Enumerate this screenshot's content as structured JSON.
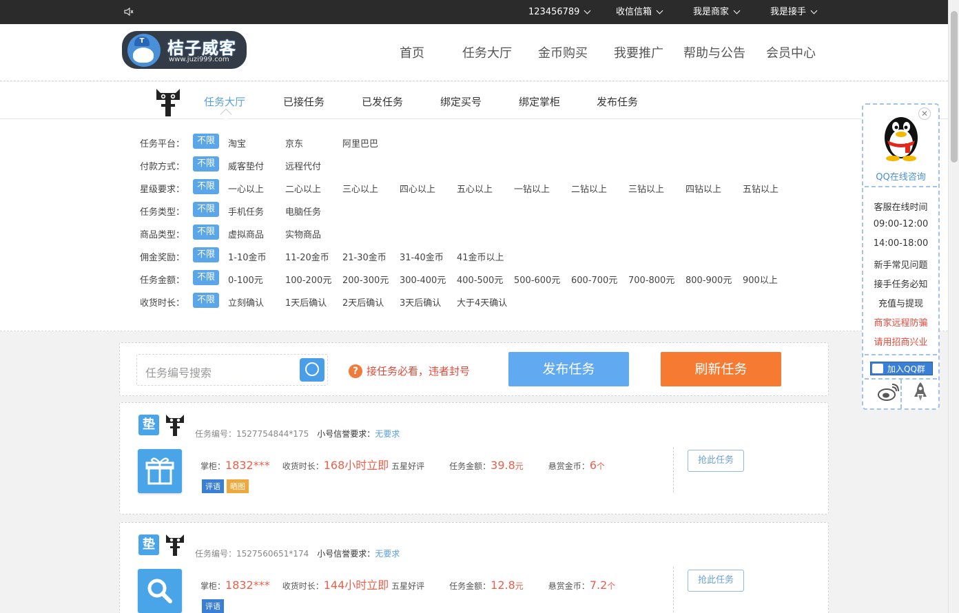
{
  "topbar": {
    "account": "123456789",
    "inbox": "收信信箱",
    "merchant": "我是商家",
    "receiver": "我是接手"
  },
  "logo": {
    "name": "桔子威客",
    "url": "www.juzi999.com",
    "hat_letter": "T"
  },
  "main_nav": [
    "首页",
    "任务大厅",
    "金币购买",
    "我要推广",
    "帮助与公告",
    "会员中心"
  ],
  "sub_nav": {
    "items": [
      "任务大厅",
      "已接任务",
      "已发任务",
      "绑定买号",
      "绑定掌柜",
      "发布任务"
    ],
    "active_index": 0
  },
  "filters": [
    {
      "label": "任务平台：",
      "badge": "不限",
      "options": [
        "淘宝",
        "京东",
        "阿里巴巴"
      ]
    },
    {
      "label": "付款方式：",
      "badge": "不限",
      "options": [
        "威客垫付",
        "远程代付"
      ]
    },
    {
      "label": "星级要求：",
      "badge": "不限",
      "options": [
        "一心以上",
        "二心以上",
        "三心以上",
        "四心以上",
        "五心以上",
        "一钻以上",
        "二钻以上",
        "三钻以上",
        "四钻以上",
        "五钻以上"
      ]
    },
    {
      "label": "任务类型：",
      "badge": "不限",
      "options": [
        "手机任务",
        "电脑任务"
      ]
    },
    {
      "label": "商品类型：",
      "badge": "不限",
      "options": [
        "虚拟商品",
        "实物商品"
      ]
    },
    {
      "label": "佣金奖励：",
      "badge": "不限",
      "options": [
        "1-10金币",
        "11-20金币",
        "21-30金币",
        "31-40金币",
        "41金币以上"
      ]
    },
    {
      "label": "任务金额：",
      "badge": "不限",
      "options": [
        "0-100元",
        "100-200元",
        "200-300元",
        "300-400元",
        "400-500元",
        "500-600元",
        "600-700元",
        "700-800元",
        "800-900元",
        "900以上"
      ]
    },
    {
      "label": "收货时长：",
      "badge": "不限",
      "options": [
        "立刻确认",
        "1天后确认",
        "2天后确认",
        "3天后确认",
        "大于4天确认"
      ]
    }
  ],
  "actions": {
    "search_placeholder": "任务编号搜索",
    "notice": "接任务必看，违者封号",
    "notice_icon": "?",
    "publish": "发布任务",
    "refresh": "刷新任务"
  },
  "tasks": [
    {
      "platform_tag": "垫",
      "id_label": "任务编号：",
      "id": "1527754844*175",
      "req_label": "小号信誉要求：",
      "req": "无要求",
      "icon": "gift-icon",
      "shop_label": "掌柜：",
      "shop": "1832***",
      "time_label": "收货时长：",
      "time": "168小时立即",
      "rating": "五星好评",
      "amount_label": "任务金额：",
      "amount": "39.8",
      "amount_unit": "元",
      "reward_label": "悬赏金币：",
      "reward": "6",
      "reward_unit": "个",
      "chips": [
        "评语",
        "晒图"
      ],
      "grab": "抢此任务"
    },
    {
      "platform_tag": "垫",
      "id_label": "任务编号：",
      "id": "1527560651*174",
      "req_label": "小号信誉要求：",
      "req": "无要求",
      "icon": "search-icon",
      "shop_label": "掌柜：",
      "shop": "1832***",
      "time_label": "收货时长：",
      "time": "144小时立即",
      "rating": "五星好评",
      "amount_label": "任务金额：",
      "amount": "12.8",
      "amount_unit": "元",
      "reward_label": "悬赏金币：",
      "reward": "7.2",
      "reward_unit": "个",
      "chips": [
        "评语"
      ],
      "grab": "抢此任务"
    }
  ],
  "float_panel": {
    "close": "✕",
    "qq": "QQ在线咨询",
    "lines": [
      "客服在线时间",
      "09:00-12:00",
      "14:00-18:00",
      "新手常见问题",
      "接手任务必知",
      "充值与提现"
    ],
    "red_lines": [
      "商家远程防骗",
      "请用招商兴业"
    ],
    "join_qq": "加入QQ群"
  },
  "colors": {
    "accent_blue": "#61aaf2",
    "accent_orange": "#f67a32",
    "price_red": "#e8604a",
    "topbar": "#2b2b2b"
  }
}
